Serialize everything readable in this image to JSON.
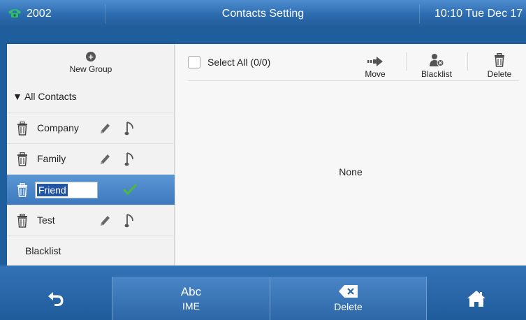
{
  "status_bar": {
    "extension": "2002",
    "title": "Contacts Setting",
    "clock": "10:10 Tue Dec 17",
    "phone_icon": "phone-icon",
    "phone_icon_color": "#2fbf6a"
  },
  "left_panel": {
    "new_group_label": "New Group",
    "all_contacts_label": "▼ All Contacts",
    "groups": [
      {
        "label": "Company"
      },
      {
        "label": "Family"
      },
      {
        "label": "Friend",
        "editing": true
      },
      {
        "label": "Test"
      }
    ],
    "blacklist_label": "Blacklist"
  },
  "right_panel": {
    "select_all_label": "Select All (0/0)",
    "toolbar": {
      "move_label": "Move",
      "blacklist_label": "Blacklist",
      "delete_label": "Delete"
    },
    "empty_message": "None"
  },
  "softkeys": {
    "back_icon": "back-arrow-icon",
    "ime_value": "Abc",
    "ime_label": "IME",
    "delete_label": "Delete",
    "home_icon": "home-icon"
  },
  "colors": {
    "accent": "#2b6aad",
    "selected_row": "#3c79bd",
    "check_green": "#4cb843"
  }
}
